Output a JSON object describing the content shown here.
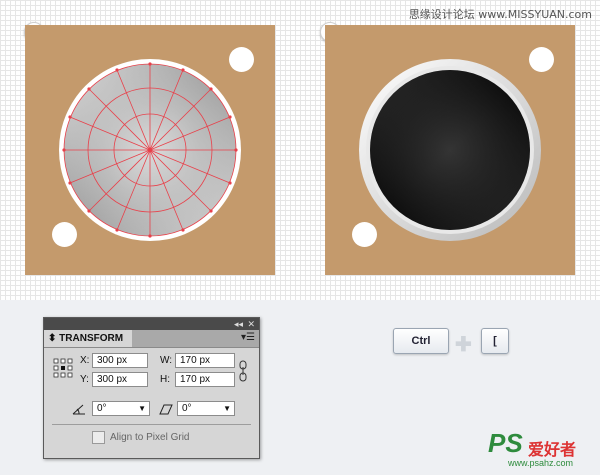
{
  "watermark_top": "思缘设计论坛 www.MISSYUAN.com",
  "steps": [
    "1",
    "2"
  ],
  "transform_panel": {
    "title": "TRANSFORM",
    "x_label": "X:",
    "x_value": "300 px",
    "y_label": "Y:",
    "y_value": "300 px",
    "w_label": "W:",
    "w_value": "170 px",
    "h_label": "H:",
    "h_value": "170 px",
    "rotate_value": "0°",
    "shear_value": "0°",
    "align_label": "Align to Pixel Grid"
  },
  "keys": [
    "Ctrl",
    "["
  ],
  "logo": {
    "ps": "PS",
    "cn": "爱好者",
    "url": "www.psahz.com"
  },
  "colors": {
    "artboard": "#c49a6c",
    "grid": "#e6e6e6",
    "panel": "#d6d6d6",
    "guides": "#e8404a"
  }
}
